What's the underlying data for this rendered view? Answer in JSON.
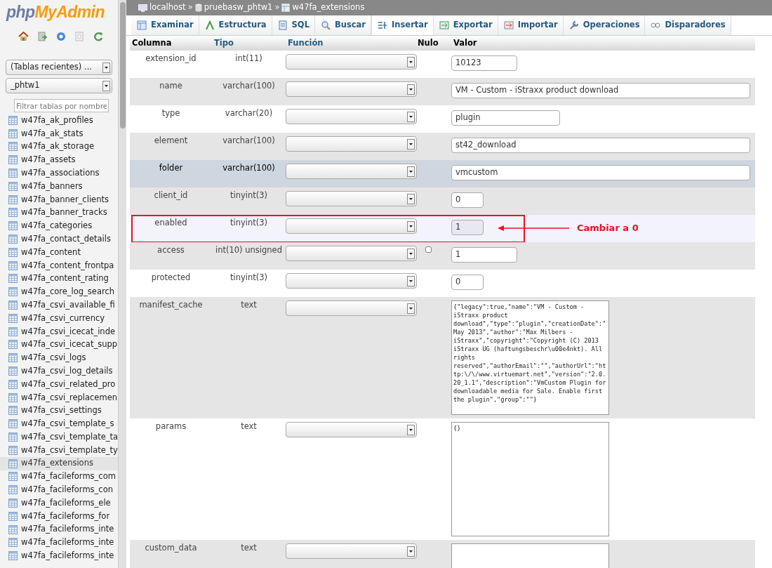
{
  "logo": {
    "prefix": "php",
    "name": "MyAdmin"
  },
  "recent_tables": {
    "value": "(Tablas recientes) ..."
  },
  "database_select": {
    "value": "_phtw1"
  },
  "table_filter": {
    "placeholder": "Filtrar tablas por nombre"
  },
  "tables": [
    {
      "name": "w47fa_ak_profiles",
      "selected": false
    },
    {
      "name": "w47fa_ak_stats",
      "selected": false
    },
    {
      "name": "w47fa_ak_storage",
      "selected": false
    },
    {
      "name": "w47fa_assets",
      "selected": false
    },
    {
      "name": "w47fa_associations",
      "selected": false
    },
    {
      "name": "w47fa_banners",
      "selected": false
    },
    {
      "name": "w47fa_banner_clients",
      "selected": false
    },
    {
      "name": "w47fa_banner_tracks",
      "selected": false
    },
    {
      "name": "w47fa_categories",
      "selected": false
    },
    {
      "name": "w47fa_contact_details",
      "selected": false
    },
    {
      "name": "w47fa_content",
      "selected": false
    },
    {
      "name": "w47fa_content_frontpa",
      "selected": false
    },
    {
      "name": "w47fa_content_rating",
      "selected": false
    },
    {
      "name": "w47fa_core_log_search",
      "selected": false
    },
    {
      "name": "w47fa_csvi_available_fi",
      "selected": false
    },
    {
      "name": "w47fa_csvi_currency",
      "selected": false
    },
    {
      "name": "w47fa_csvi_icecat_inde",
      "selected": false
    },
    {
      "name": "w47fa_csvi_icecat_supp",
      "selected": false
    },
    {
      "name": "w47fa_csvi_logs",
      "selected": false
    },
    {
      "name": "w47fa_csvi_log_details",
      "selected": false
    },
    {
      "name": "w47fa_csvi_related_pro",
      "selected": false
    },
    {
      "name": "w47fa_csvi_replacemen",
      "selected": false
    },
    {
      "name": "w47fa_csvi_settings",
      "selected": false
    },
    {
      "name": "w47fa_csvi_template_s",
      "selected": false
    },
    {
      "name": "w47fa_csvi_template_ta",
      "selected": false
    },
    {
      "name": "w47fa_csvi_template_ty",
      "selected": false
    },
    {
      "name": "w47fa_extensions",
      "selected": true
    },
    {
      "name": "w47fa_facileforms_com",
      "selected": false
    },
    {
      "name": "w47fa_facileforms_con",
      "selected": false
    },
    {
      "name": "w47fa_facileforms_ele",
      "selected": false
    },
    {
      "name": "w47fa_facileforms_for",
      "selected": false
    },
    {
      "name": "w47fa_facileforms_inte",
      "selected": false
    },
    {
      "name": "w47fa_facileforms_inte",
      "selected": false
    },
    {
      "name": "w47fa_facileforms_inte",
      "selected": false
    }
  ],
  "breadcrumb": [
    {
      "kind": "server",
      "label": "localhost"
    },
    {
      "kind": "database",
      "separator": "»",
      "label": "pruebasw_phtw1"
    },
    {
      "kind": "table",
      "separator": "»",
      "label": "w47fa_extensions"
    }
  ],
  "tabs": [
    {
      "kind": "browse",
      "label": "Examinar",
      "selected": false
    },
    {
      "kind": "structure",
      "label": "Estructura",
      "selected": false
    },
    {
      "kind": "sql",
      "label": "SQL",
      "selected": false
    },
    {
      "kind": "search",
      "label": "Buscar",
      "selected": false
    },
    {
      "kind": "insert",
      "label": "Insertar",
      "selected": true
    },
    {
      "kind": "export",
      "label": "Exportar",
      "selected": false
    },
    {
      "kind": "import",
      "label": "Importar",
      "selected": false
    },
    {
      "kind": "operations",
      "label": "Operaciones",
      "selected": false
    },
    {
      "kind": "triggers",
      "label": "Disparadores",
      "selected": false
    }
  ],
  "table": {
    "columns": [
      "Columna",
      "Tipo",
      "Función",
      "Nulo",
      "Valor"
    ],
    "rows": [
      {
        "column": "extension_id",
        "type": "int(11)",
        "kind": "medium",
        "value": "10123",
        "highlighted": false
      },
      {
        "column": "name",
        "type": "varchar(100)",
        "kind": "long",
        "value": "VM - Custom - iStraxx product download",
        "highlighted": false
      },
      {
        "column": "type",
        "type": "varchar(20)",
        "kind": "wide",
        "value": "plugin",
        "highlighted": false
      },
      {
        "column": "element",
        "type": "varchar(100)",
        "kind": "long",
        "value": "st42_download",
        "highlighted": false
      },
      {
        "column": "folder",
        "type": "varchar(100)",
        "kind": "long",
        "value": "vmcustom",
        "highlighted": true
      },
      {
        "column": "client_id",
        "type": "tinyint(3)",
        "kind": "short",
        "value": "0",
        "highlighted": false
      },
      {
        "column": "enabled",
        "type": "tinyint(3)",
        "kind": "short",
        "value": "1",
        "highlighted": false,
        "annotation": "Cambiar a 0"
      },
      {
        "column": "access",
        "type": "int(10) unsigned",
        "kind": "medium",
        "value": "1",
        "highlighted": false,
        "null_checked": false
      },
      {
        "column": "protected",
        "type": "tinyint(3)",
        "kind": "short",
        "value": "0",
        "highlighted": false
      },
      {
        "column": "manifest_cache",
        "type": "text",
        "kind": "textarea",
        "value": "{\"legacy\":true,\"name\":\"VM - Custom - iStraxx product download\",\"type\":\"plugin\",\"creationDate\":\"May 2013\",\"author\":\"Max Milbers - iStraxx\",\"copyright\":\"Copyright (C) 2013 iStraxx UG (haftungsbeschr\\u00e4nkt). All rights reserved\",\"authorEmail\":\"\",\"authorUrl\":\"http:\\/\\/www.virtuemart.net\",\"version\":\"2.0.20_1.1\",\"description\":\"VmCustom Plugin for downloadable media for Sale. Enable first the plugin\",\"group\":\"\"}",
        "highlighted": false
      },
      {
        "column": "params",
        "type": "text",
        "kind": "textarea",
        "value": "{}",
        "highlighted": false
      },
      {
        "column": "custom_data",
        "type": "text",
        "kind": "textarea",
        "highlighted": false
      }
    ]
  }
}
